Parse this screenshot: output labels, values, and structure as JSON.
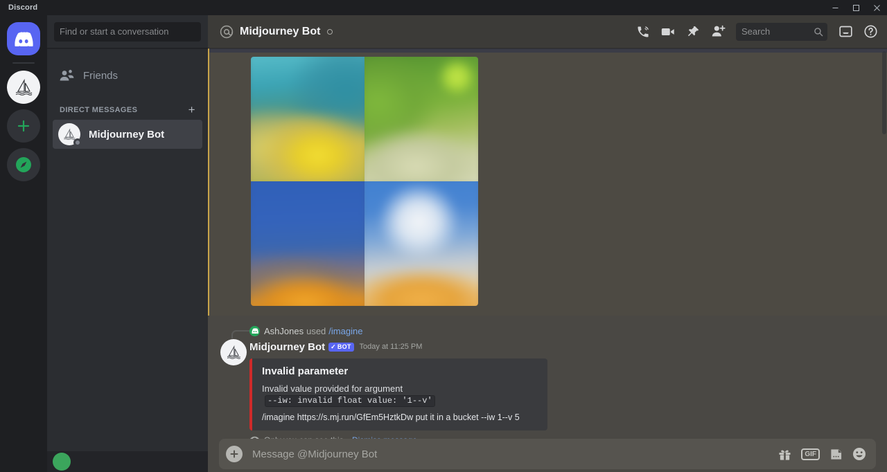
{
  "window": {
    "app_title": "Discord",
    "minimize_label": "Minimize",
    "maximize_label": "Maximize",
    "close_label": "Close"
  },
  "rail": {
    "items": [
      {
        "name": "home",
        "label": "Direct Messages",
        "icon": "discord-logo-icon",
        "active": true
      },
      {
        "name": "midjourney",
        "label": "Midjourney",
        "icon": "sailboat-icon",
        "active": false
      },
      {
        "name": "add-server",
        "label": "Add a Server",
        "icon": "plus-icon",
        "active": false
      },
      {
        "name": "explore",
        "label": "Explore Public Servers",
        "icon": "compass-icon",
        "active": false
      }
    ]
  },
  "sidebar": {
    "search_placeholder": "Find or start a conversation",
    "friends_label": "Friends",
    "section_label": "DIRECT MESSAGES",
    "add_dm_label": "+",
    "dms": [
      {
        "name": "Midjourney Bot",
        "status": "offline",
        "active": true
      }
    ]
  },
  "header": {
    "at_symbol": "@",
    "title": "Midjourney Bot",
    "tools": [
      {
        "name": "start-voice-call-icon",
        "label": "Start Voice Call"
      },
      {
        "name": "start-video-call-icon",
        "label": "Start Video Call"
      },
      {
        "name": "pinned-messages-icon",
        "label": "Pinned Messages"
      },
      {
        "name": "add-friends-icon",
        "label": "Add Friends to DM"
      }
    ],
    "search_placeholder": "Search",
    "inbox_label": "Inbox",
    "help_label": "Help"
  },
  "messages": {
    "image_grid": {
      "alt": "Midjourney 2x2 image grid result",
      "cells": [
        "upper-left",
        "upper-right",
        "lower-left",
        "lower-right"
      ]
    },
    "command": {
      "user": "AshJones",
      "used_text": "used",
      "slash_command": "/imagine"
    },
    "bot": {
      "name": "Midjourney Bot",
      "tag": "BOT",
      "tag_check": "✓",
      "timestamp": "Today at 11:25 PM"
    },
    "embed": {
      "accent_color": "#cf2a2a",
      "title": "Invalid parameter",
      "description_prefix": "Invalid value provided for argument",
      "description_code": "--iw: invalid float value: '1--v'",
      "command_echo": "/imagine https://s.mj.run/GfEm5HztkDw put it in a bucket --iw 1--v 5"
    },
    "ephemeral": {
      "text": "Only you can see this",
      "separator": "•",
      "dismiss_label": "Dismiss message"
    }
  },
  "composer": {
    "placeholder": "Message @Midjourney Bot",
    "icons": [
      {
        "name": "gift-icon",
        "label": "Send a gift"
      },
      {
        "name": "gif-icon",
        "label": "GIF"
      },
      {
        "name": "sticker-icon",
        "label": "Sticker"
      },
      {
        "name": "emoji-icon",
        "label": "Emoji"
      }
    ],
    "gif_label": "GIF"
  }
}
